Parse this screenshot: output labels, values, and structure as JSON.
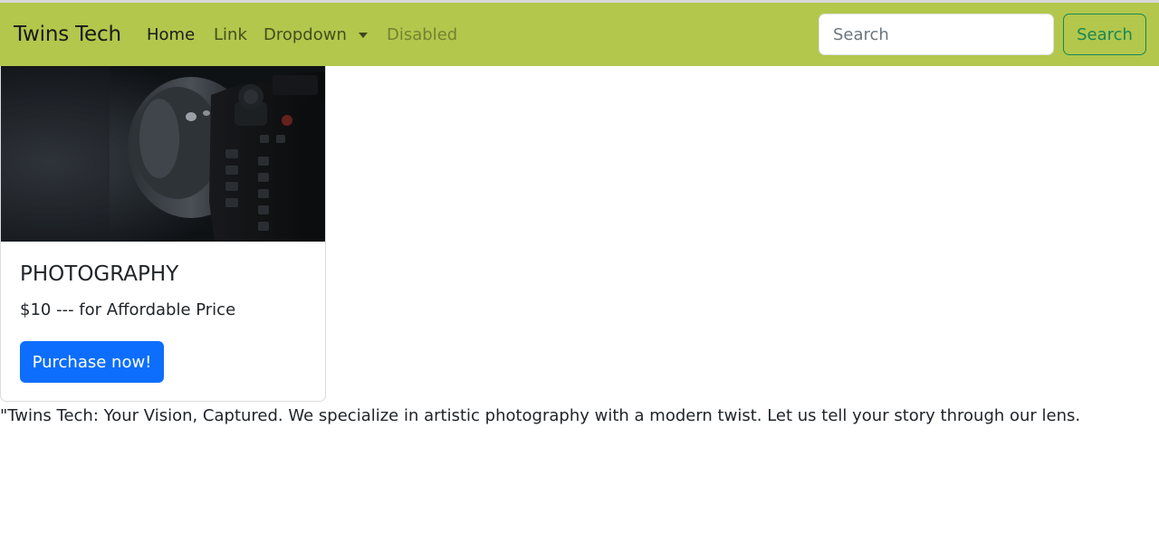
{
  "navbar": {
    "brand": "Twins Tech",
    "links": {
      "home": "Home",
      "link": "Link",
      "dropdown": "Dropdown",
      "disabled": "Disabled"
    },
    "search": {
      "placeholder": "Search",
      "value": "",
      "button_label": "Search"
    },
    "background_color": "#b2c74c"
  },
  "card": {
    "image_icon": "camera-photo",
    "title": "PHOTOGRAPHY",
    "text": "$10 --- for Affordable Price",
    "button_label": "Purchase now!",
    "button_color": "#0d6efd"
  },
  "tagline": "\"Twins Tech: Your Vision, Captured. We specialize in artistic photography with a modern twist. Let us tell your story through our lens."
}
